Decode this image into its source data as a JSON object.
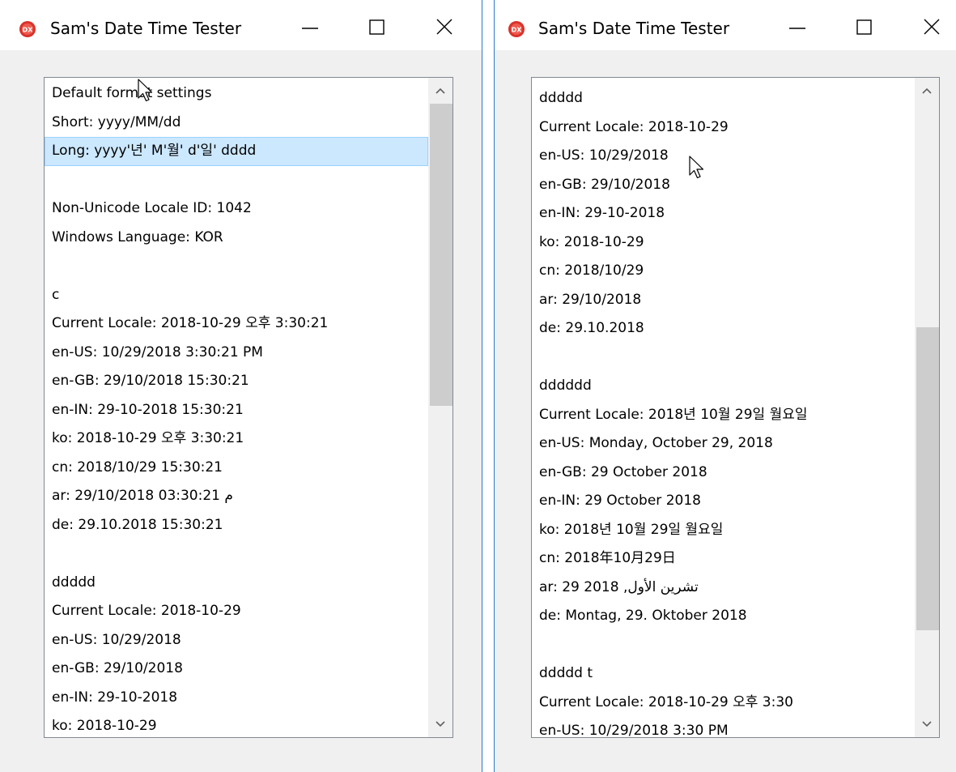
{
  "windows": [
    {
      "title": "Sam's Date Time Tester",
      "icon": "app-icon",
      "items": [
        "Default format settings",
        "Short: yyyy/MM/dd",
        "Long: yyyy'년' M'월' d'일' dddd",
        "",
        "Non-Unicode Locale ID: 1042",
        "Windows Language: KOR",
        "",
        "c",
        "Current Locale: 2018-10-29 오후 3:30:21",
        "en-US: 10/29/2018 3:30:21 PM",
        "en-GB: 29/10/2018 15:30:21",
        "en-IN: 29-10-2018 15:30:21",
        "ko: 2018-10-29 오후 3:30:21",
        "cn: 2018/10/29 15:30:21",
        "ar: 29/10/2018 03:30:21 م",
        "de: 29.10.2018 15:30:21",
        "",
        "ddddd",
        "Current Locale: 2018-10-29",
        "en-US: 10/29/2018",
        "en-GB: 29/10/2018",
        "en-IN: 29-10-2018",
        "ko: 2018-10-29"
      ],
      "selected_index": 2
    },
    {
      "title": "Sam's Date Time Tester",
      "icon": "app-icon",
      "items": [
        "ddddd",
        "Current Locale: 2018-10-29",
        "en-US: 10/29/2018",
        "en-GB: 29/10/2018",
        "en-IN: 29-10-2018",
        "ko: 2018-10-29",
        "cn: 2018/10/29",
        "ar: 29/10/2018",
        "de: 29.10.2018",
        "",
        "dddddd",
        "Current Locale: 2018년 10월 29일 월요일",
        "en-US: Monday, October 29, 2018",
        "en-GB: 29 October 2018",
        "en-IN: 29 October 2018",
        "ko: 2018년 10월 29일 월요일",
        "cn: 2018年10月29日",
        "ar: 29 تشرين الأول, 2018",
        "de: Montag, 29. Oktober 2018",
        "",
        "ddddd t",
        "Current Locale: 2018-10-29 오후 3:30",
        "en-US: 10/29/2018 3:30 PM"
      ],
      "selected_index": -1
    }
  ],
  "colors": {
    "selection_bg": "#cce8ff",
    "selection_border": "#99d1ff",
    "window_bg": "#f0f0f0",
    "accent_border": "#2b79d0",
    "icon_red": "#d9322b"
  }
}
